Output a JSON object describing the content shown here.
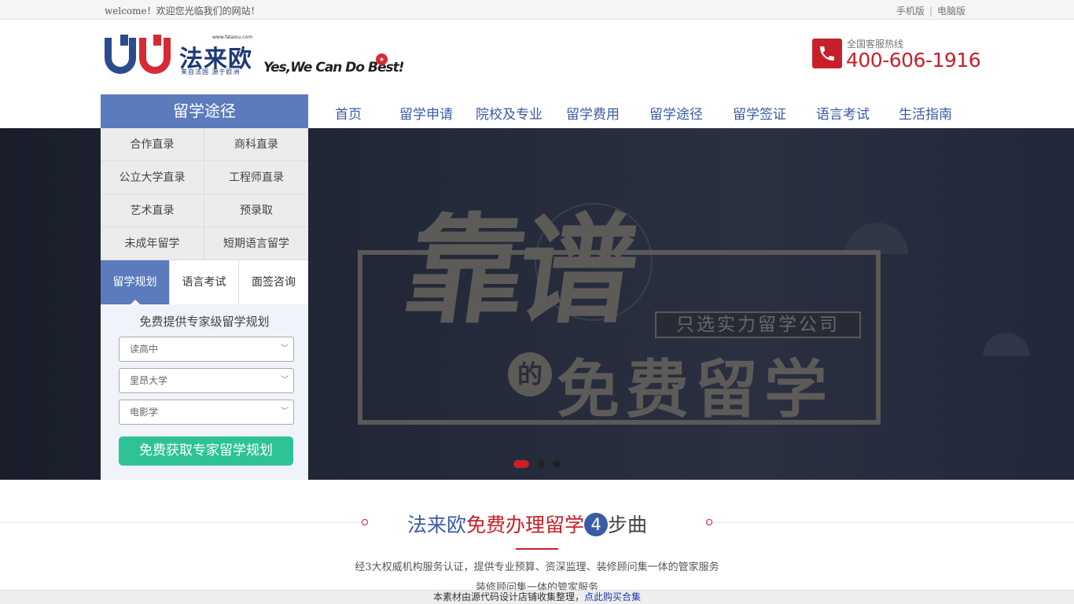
{
  "topbar": {
    "welcome": "welcome！欢迎您光临我们的网站！",
    "mobile_label": "手机版",
    "separator": "|",
    "desktop_label": "电脑版"
  },
  "header": {
    "logo_name": "法来欧",
    "logo_url": "www.falaiou.com",
    "logo_sub": "来自法国 源于欧洲",
    "slogan": "Yes,We Can Do Best!",
    "hotline_label": "全国客服热线",
    "hotline_number": "400-606-1916"
  },
  "nav": {
    "items": [
      {
        "label": "首页"
      },
      {
        "label": "留学申请"
      },
      {
        "label": "院校及专业"
      },
      {
        "label": "留学费用"
      },
      {
        "label": "留学途径"
      },
      {
        "label": "留学签证"
      },
      {
        "label": "语言考试"
      },
      {
        "label": "生活指南"
      }
    ]
  },
  "panel": {
    "title": "留学途径",
    "links": [
      "合作直录",
      "商科直录",
      "公立大学直录",
      "工程师直录",
      "艺术直录",
      "预录取",
      "未成年留学",
      "短期语言留学"
    ],
    "tabs": [
      "留学规划",
      "语言考试",
      "面签咨询"
    ],
    "active_tab": "留学规划",
    "form_title": "免费提供专家级留学规划",
    "selects": [
      {
        "value": "读高中"
      },
      {
        "value": "里昂大学"
      },
      {
        "value": "电影学"
      }
    ],
    "cta": "免费获取专家留学规划"
  },
  "banner": {
    "headline": "靠谱",
    "tag": "只选实力留学公司",
    "circle_char": "的",
    "subline": "免费留学",
    "slide_count": 3,
    "active_slide": 1
  },
  "steps": {
    "brand": "法来欧",
    "highlight": "免费办理留学",
    "number": "4",
    "suffix": "步曲",
    "desc_line1": "经3大权威机构服务认证，提供专业预算、资深监理、装修顾问集一体的管家服务",
    "desc_line2": "装修顾问集一体的管家服务"
  },
  "notice": {
    "text": "本素材由源代码设计店铺收集整理，",
    "link": "点此购买合集"
  },
  "colors": {
    "brand_blue": "#3a5ba5",
    "panel_blue": "#5b7bbd",
    "brand_red": "#c8202b",
    "cta_green": "#2ec394"
  }
}
